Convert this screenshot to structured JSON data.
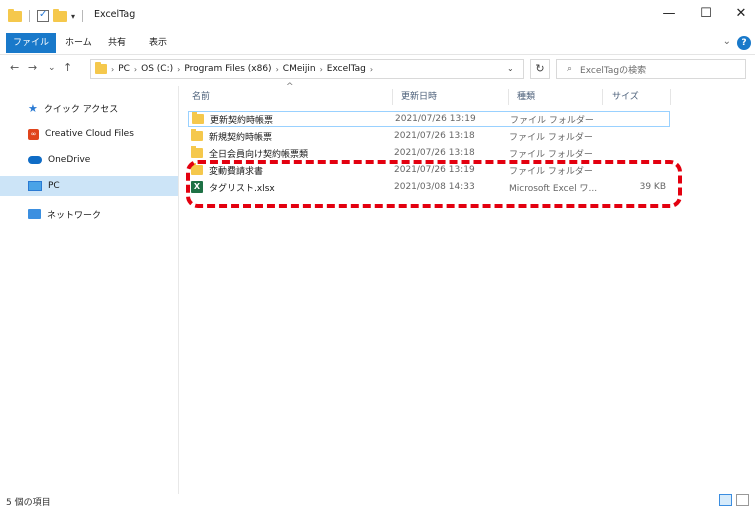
{
  "window": {
    "title": "ExcelTag",
    "minimize": "—",
    "maximize": "☐",
    "close": "✕"
  },
  "ribbon": {
    "tabs": [
      "ファイル",
      "ホーム",
      "共有",
      "表示"
    ],
    "help": "?"
  },
  "nav": {
    "back": "←",
    "forward": "→",
    "recent": "⌄",
    "up": "↑"
  },
  "address": {
    "crumbs": [
      "PC",
      "OS (C:)",
      "Program Files (x86)",
      "CMeijin",
      "ExcelTag"
    ],
    "dropdown": "⌄",
    "refresh": "↻"
  },
  "search": {
    "placeholder": "ExcelTagの検索"
  },
  "sidebar": {
    "items": [
      {
        "label": "クイック アクセス",
        "icon": "star-icon"
      },
      {
        "label": "Creative Cloud Files",
        "icon": "creative-cloud-icon"
      },
      {
        "label": "OneDrive",
        "icon": "cloud-icon"
      },
      {
        "label": "PC",
        "icon": "pc-icon",
        "selected": true
      },
      {
        "label": "ネットワーク",
        "icon": "network-icon"
      }
    ]
  },
  "columns": {
    "name": "名前",
    "date": "更新日時",
    "type": "種類",
    "size": "サイズ"
  },
  "files": [
    {
      "name": "更新契約時帳票",
      "date": "2021/07/26 13:19",
      "type": "ファイル フォルダー",
      "size": "",
      "icon": "folder-icon"
    },
    {
      "name": "新規契約時帳票",
      "date": "2021/07/26 13:18",
      "type": "ファイル フォルダー",
      "size": "",
      "icon": "folder-icon"
    },
    {
      "name": "全日会員向け契約帳票類",
      "date": "2021/07/26 13:18",
      "type": "ファイル フォルダー",
      "size": "",
      "icon": "folder-icon"
    },
    {
      "name": "変動費請求書",
      "date": "2021/07/26 13:19",
      "type": "ファイル フォルダー",
      "size": "",
      "icon": "folder-icon"
    },
    {
      "name": "タグリスト.xlsx",
      "date": "2021/03/08 14:33",
      "type": "Microsoft Excel ワ...",
      "size": "39 KB",
      "icon": "excel-icon"
    }
  ],
  "status": {
    "count": "5 個の項目"
  },
  "colors": {
    "accent": "#1979ca",
    "highlight": "#e3000f",
    "selected": "#cce4f7"
  }
}
